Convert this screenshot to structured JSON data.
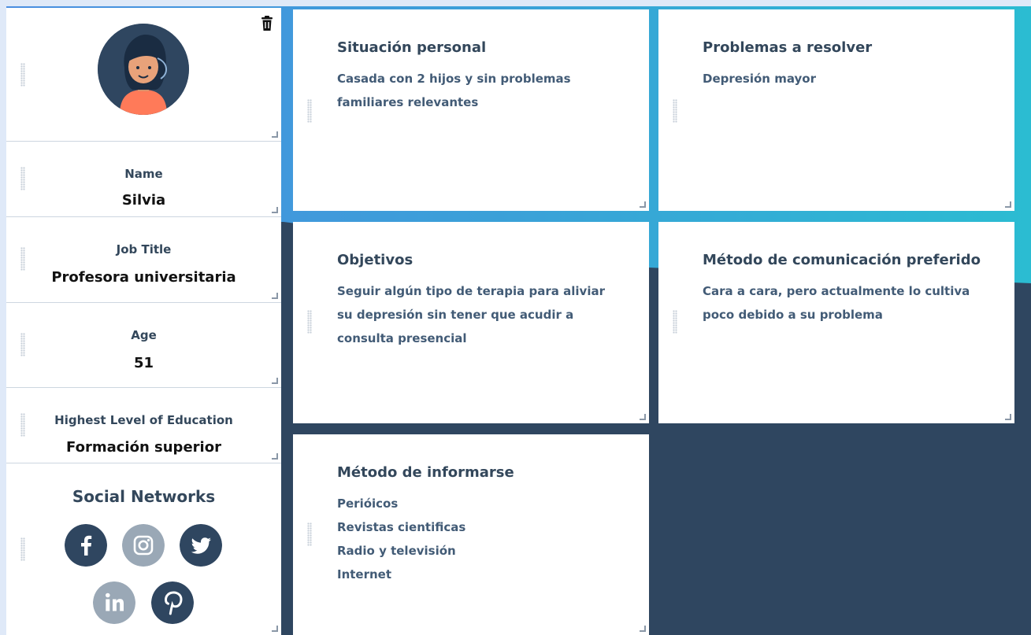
{
  "profile": {
    "name_label": "Name",
    "name_value": "Silvia",
    "job_label": "Job Title",
    "job_value": "Profesora universitaria",
    "age_label": "Age",
    "age_value": "51",
    "education_label": "Highest Level of Education",
    "education_value": "Formación superior"
  },
  "social": {
    "title": "Social Networks",
    "networks": [
      "facebook",
      "instagram",
      "twitter",
      "linkedin",
      "pinterest"
    ]
  },
  "cards": {
    "situacion": {
      "title": "Situación personal",
      "lines": [
        "Casada con 2 hijos y sin problemas",
        "familiares relevantes"
      ]
    },
    "problemas": {
      "title": "Problemas a resolver",
      "lines": [
        "Depresión mayor"
      ]
    },
    "objetivos": {
      "title": "Objetivos",
      "lines": [
        "Seguir algún tipo de terapia para aliviar",
        "su depresión sin tener que acudir a",
        "consulta presencial"
      ]
    },
    "comunicacion": {
      "title": "Método de comunicación preferido",
      "lines": [
        "Cara a cara, pero actualmente lo cultiva",
        "poco debido a su problema"
      ]
    },
    "informarse": {
      "title": "Método de informarse",
      "lines": [
        "Perióicos",
        "Revistas cientificas",
        "Radio y televisión",
        "Internet"
      ]
    }
  },
  "colors": {
    "dark_navy": "#2f4660",
    "gradient_start": "#4a8ee0",
    "gradient_end": "#2bbcd2",
    "avatar_shirt": "#ff7a59",
    "instagram_disabled": "#9aa8b6",
    "linkedin_disabled": "#9aa8b6"
  },
  "icons": [
    "trash-icon",
    "facebook-icon",
    "instagram-icon",
    "twitter-icon",
    "linkedin-icon",
    "pinterest-icon",
    "drag-handle-icon",
    "resize-handle-icon"
  ]
}
